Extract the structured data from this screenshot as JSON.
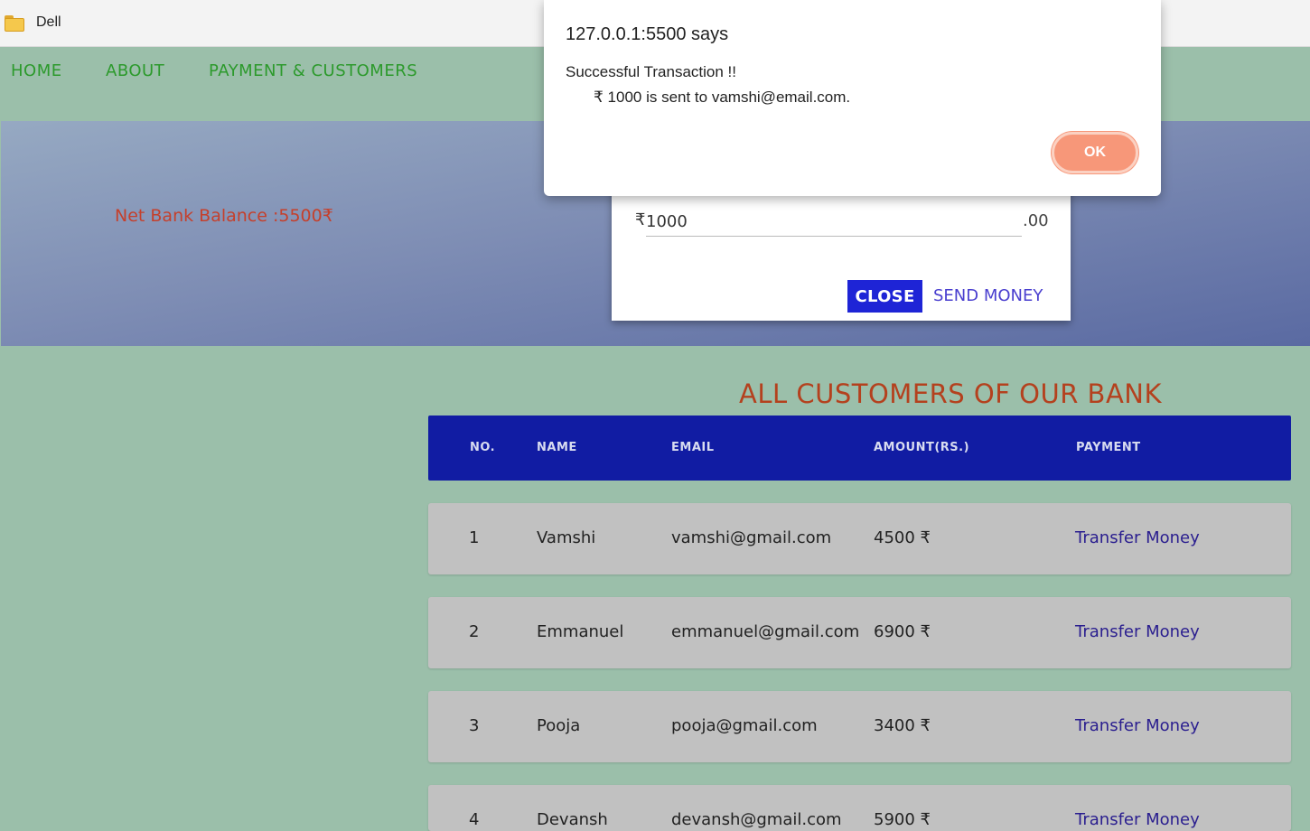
{
  "bookmarks": {
    "items": [
      {
        "label": "Dell",
        "icon": "folder-icon"
      }
    ]
  },
  "nav": {
    "home": "HOME",
    "about": "ABOUT",
    "payment": "PAYMENT & CUSTOMERS"
  },
  "hero": {
    "balance": "Net Bank Balance :5500₹"
  },
  "send_modal": {
    "prefix": "₹",
    "amount_value": "1000",
    "suffix": ".00",
    "close_label": "CLOSE",
    "send_label": "SEND MONEY"
  },
  "alert": {
    "title": "127.0.0.1:5500 says",
    "line1": "Successful Transaction !!",
    "line2": "₹ 1000 is sent to vamshi@email.com.",
    "ok_label": "OK"
  },
  "customers": {
    "title": "ALL CUSTOMERS OF OUR BANK",
    "headers": [
      "NO.",
      "NAME",
      "EMAIL",
      "AMOUNT(RS.)",
      "PAYMENT"
    ],
    "rows": [
      {
        "no": "1",
        "name": "Vamshi",
        "email": "vamshi@gmail.com",
        "amount": "4500 ₹",
        "action": "Transfer Money"
      },
      {
        "no": "2",
        "name": "Emmanuel",
        "email": "emmanuel@gmail.com",
        "amount": "6900 ₹",
        "action": "Transfer Money"
      },
      {
        "no": "3",
        "name": "Pooja",
        "email": "pooja@gmail.com",
        "amount": "3400 ₹",
        "action": "Transfer Money"
      },
      {
        "no": "4",
        "name": "Devansh",
        "email": "devansh@gmail.com",
        "amount": "5900 ₹",
        "action": "Transfer Money"
      }
    ]
  },
  "colors": {
    "page_bg": "#9bbfaa",
    "nav_link": "#2c9a2c",
    "table_header": "#111ca3",
    "accent_title": "#b4411e",
    "ok_button": "#f79779",
    "close_button": "#1e24d6"
  }
}
